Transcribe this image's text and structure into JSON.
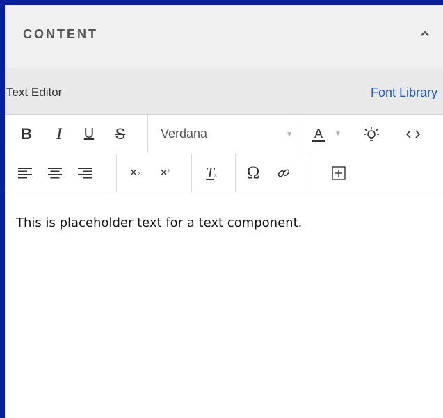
{
  "panel": {
    "title": "CONTENT",
    "collapse_icon": "chevron-up-icon"
  },
  "subbar": {
    "left_label": "Text Editor",
    "right_link": "Font Library"
  },
  "toolbar": {
    "bold": "B",
    "italic": "I",
    "underline": "U",
    "strike": "S",
    "font_family": "Verdana",
    "text_color_label": "A",
    "subscript": "×",
    "subscript_small": "₂",
    "superscript": "×",
    "superscript_small": "²",
    "clear_format": "T",
    "clear_format_small": "ₓ",
    "special_char": "Ω"
  },
  "editor": {
    "content": "This is placeholder text for a text component."
  },
  "colors": {
    "frame": "#0a1f9c",
    "link": "#1a57c8"
  }
}
